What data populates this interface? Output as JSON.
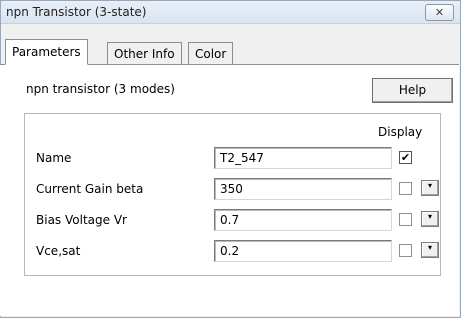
{
  "window": {
    "title": "npn Transistor (3-state)",
    "close_glyph": "✕"
  },
  "tabs": [
    {
      "label": "Parameters",
      "active": true
    },
    {
      "label": "Other Info",
      "active": false
    },
    {
      "label": "Color",
      "active": false
    }
  ],
  "panel": {
    "heading": "npn transistor (3 modes)",
    "help_label": "Help",
    "display_header": "Display"
  },
  "rows": [
    {
      "label": "Name",
      "value": "T2_547",
      "display_checked": true,
      "has_dropdown": false
    },
    {
      "label": "Current Gain beta",
      "value": "350",
      "display_checked": false,
      "has_dropdown": true
    },
    {
      "label": "Bias Voltage Vr",
      "value": "0.7",
      "display_checked": false,
      "has_dropdown": true
    },
    {
      "label": "Vce,sat",
      "value": "0.2",
      "display_checked": false,
      "has_dropdown": true
    }
  ],
  "icons": {
    "checkmark": "✔",
    "dropdown": "▾"
  }
}
